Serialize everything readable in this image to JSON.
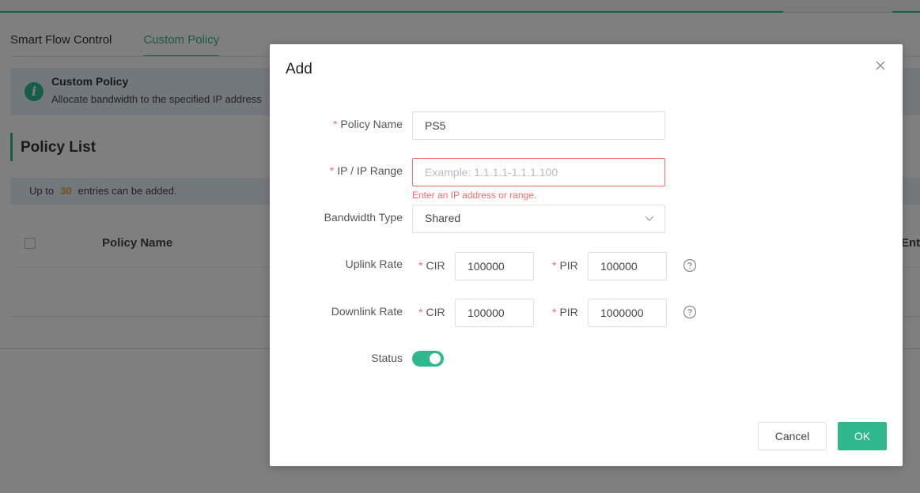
{
  "tabs": [
    {
      "label": "Smart Flow Control"
    },
    {
      "label": "Custom Policy"
    }
  ],
  "info": {
    "title": "Custom Policy",
    "description": "Allocate bandwidth to the specified IP address"
  },
  "policy_list": {
    "title": "Policy List",
    "limit_prefix": "Up to",
    "limit_count": "30",
    "limit_suffix": "entries can be added.",
    "columns": [
      "Policy Name",
      "Ente"
    ]
  },
  "modal": {
    "title": "Add",
    "close_icon": "close-icon",
    "fields": {
      "policy_name": {
        "label": "Policy Name",
        "value": "PS5"
      },
      "ip_range": {
        "label": "IP / IP Range",
        "placeholder": "Example: 1.1.1.1-1.1.1.100",
        "value": "",
        "error": "Enter an IP address or range."
      },
      "bandwidth_type": {
        "label": "Bandwidth Type",
        "selected": "Shared"
      },
      "uplink": {
        "label": "Uplink Rate",
        "cir_label": "CIR",
        "cir_value": "100000",
        "pir_label": "PIR",
        "pir_value": "100000"
      },
      "downlink": {
        "label": "Downlink Rate",
        "cir_label": "CIR",
        "cir_value": "100000",
        "pir_label": "PIR",
        "pir_value": "1000000"
      },
      "status": {
        "label": "Status",
        "enabled": true
      }
    },
    "buttons": {
      "cancel": "Cancel",
      "ok": "OK"
    }
  },
  "colors": {
    "accent": "#2fb88c",
    "error": "#f56c6c",
    "limit_highlight": "#e6a23c"
  }
}
